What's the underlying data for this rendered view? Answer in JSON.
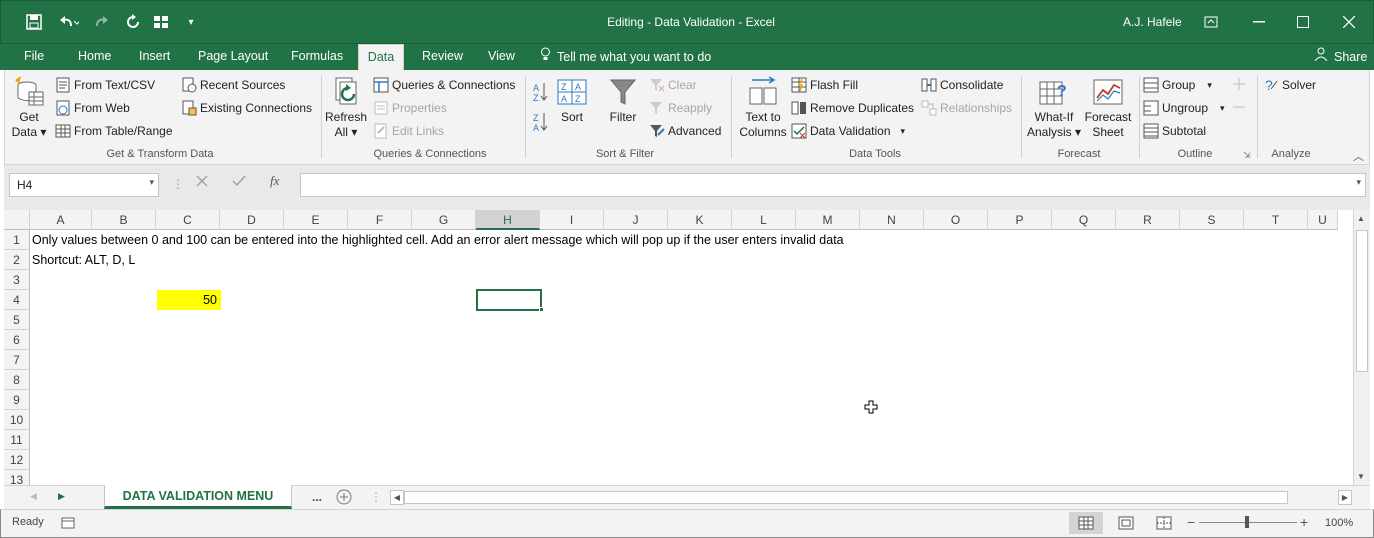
{
  "window": {
    "title": "Editing - Data Validation  -  Excel",
    "user": "A.J. Hafele"
  },
  "tabs": [
    "File",
    "Home",
    "Insert",
    "Page Layout",
    "Formulas",
    "Data",
    "Review",
    "View"
  ],
  "active_tab": "Data",
  "tell_me": "Tell me what you want to do",
  "share": "Share",
  "ribbon": {
    "get_transform": {
      "get_data_1": "Get",
      "get_data_2": "Data",
      "from_text_csv": "From Text/CSV",
      "from_web": "From Web",
      "from_table_range": "From Table/Range",
      "recent_sources": "Recent Sources",
      "existing_connections": "Existing Connections",
      "label": "Get & Transform Data"
    },
    "queries": {
      "refresh_1": "Refresh",
      "refresh_2": "All",
      "queries_connections": "Queries & Connections",
      "properties": "Properties",
      "edit_links": "Edit Links",
      "label": "Queries & Connections"
    },
    "sort_filter": {
      "sort": "Sort",
      "filter": "Filter",
      "clear": "Clear",
      "reapply": "Reapply",
      "advanced": "Advanced",
      "label": "Sort & Filter"
    },
    "data_tools": {
      "text_to_columns_1": "Text to",
      "text_to_columns_2": "Columns",
      "flash_fill": "Flash Fill",
      "remove_duplicates": "Remove Duplicates",
      "data_validation": "Data Validation",
      "consolidate": "Consolidate",
      "relationships": "Relationships",
      "label": "Data Tools"
    },
    "forecast": {
      "what_if_1": "What-If",
      "what_if_2": "Analysis",
      "forecast_sheet_1": "Forecast",
      "forecast_sheet_2": "Sheet",
      "label": "Forecast"
    },
    "outline": {
      "group": "Group",
      "ungroup": "Ungroup",
      "subtotal": "Subtotal",
      "label": "Outline"
    },
    "analyze": {
      "solver": "Solver",
      "label": "Analyze"
    }
  },
  "name_box": "H4",
  "formula": "",
  "columns": [
    "A",
    "B",
    "C",
    "D",
    "E",
    "F",
    "G",
    "H",
    "I",
    "J",
    "K",
    "L",
    "M",
    "N",
    "O",
    "P",
    "Q",
    "R",
    "S",
    "T",
    "U"
  ],
  "selected_column": "H",
  "rows": [
    "1",
    "2",
    "3",
    "4",
    "5",
    "6",
    "7",
    "8",
    "9",
    "10",
    "11",
    "12",
    "13"
  ],
  "cells": {
    "A1": "Only values between 0 and 100 can be entered into the highlighted cell.  Add an error alert message which will pop up if the user enters invalid data",
    "A2": "Shortcut: ALT, D, L",
    "C4": "50"
  },
  "highlight_color": "#FFFF00",
  "sheet_tab": "DATA VALIDATION MENU",
  "sheet_more": "...",
  "status": "Ready",
  "zoom": "100%",
  "accent_color": "#217346"
}
